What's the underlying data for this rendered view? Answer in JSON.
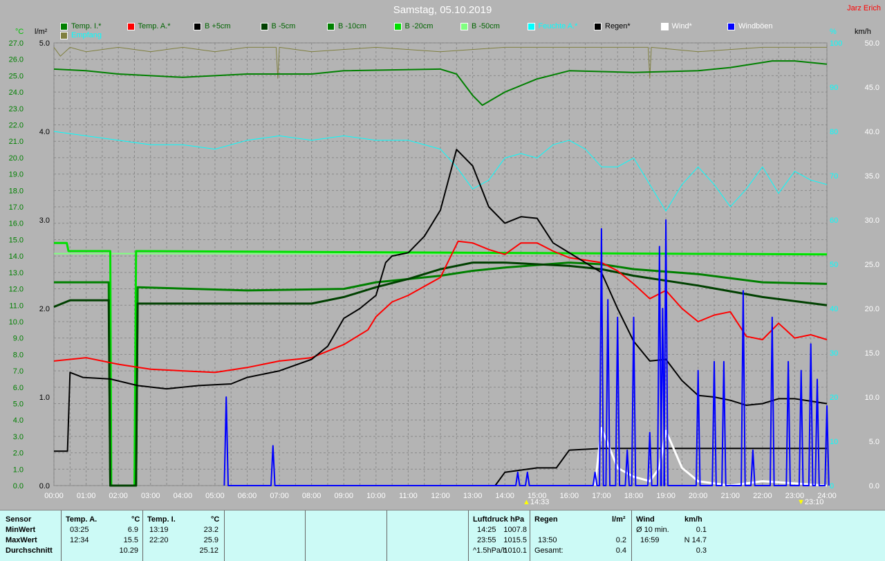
{
  "title": "Samstag, 05.10.2019",
  "author": "Jarz Erich",
  "legend": [
    {
      "label": "Temp. I.*",
      "color": "#008000",
      "text": "#006400"
    },
    {
      "label": "Temp. A.*",
      "color": "#ff0000",
      "text": "#006400"
    },
    {
      "label": "B +5cm",
      "color": "#000000",
      "text": "#006400"
    },
    {
      "label": "B -5cm",
      "color": "#004000",
      "text": "#006400"
    },
    {
      "label": "B -10cm",
      "color": "#008000",
      "text": "#006400"
    },
    {
      "label": "B -20cm",
      "color": "#00e000",
      "text": "#006400"
    },
    {
      "label": "B -50cm",
      "color": "#80ff80",
      "text": "#006400"
    },
    {
      "label": "Feuchte A.*",
      "color": "#00ffff",
      "text": "#00ffff"
    },
    {
      "label": "Regen*",
      "color": "#000000",
      "text": "#000000"
    },
    {
      "label": "Wind*",
      "color": "#ffffff",
      "text": "#ffffff"
    },
    {
      "label": "Windböen",
      "color": "#0000ff",
      "text": "#ffffff"
    },
    {
      "label": "Empfang",
      "color": "#808040",
      "text": "#00ffff"
    }
  ],
  "axes": {
    "left1_unit": "°C",
    "left2_unit": "l/m²",
    "right1_unit": "%",
    "right2_unit": "km/h"
  },
  "markers": {
    "sunrise": "14:33",
    "sunset": "23:10"
  },
  "chart_data": {
    "type": "line",
    "x_unit": "hour",
    "xlim": [
      0,
      24
    ],
    "x_ticks": [
      "00:00",
      "01:00",
      "02:00",
      "03:00",
      "04:00",
      "05:00",
      "06:00",
      "07:00",
      "08:00",
      "09:00",
      "10:00",
      "11:00",
      "12:00",
      "13:00",
      "14:00",
      "15:00",
      "16:00",
      "17:00",
      "18:00",
      "19:00",
      "20:00",
      "21:00",
      "22:00",
      "23:00",
      "24:00"
    ],
    "y_temp": [
      0,
      27
    ],
    "y_rain": [
      0,
      5
    ],
    "y_hum": [
      0,
      100
    ],
    "y_wind": [
      0,
      50
    ],
    "series": [
      {
        "name": "Empfang",
        "axis": "hum",
        "color": "#808040",
        "width": 1,
        "values": [
          [
            0,
            99
          ],
          [
            0.2,
            97
          ],
          [
            0.5,
            99
          ],
          [
            1,
            98
          ],
          [
            2,
            99
          ],
          [
            3,
            98
          ],
          [
            4,
            99
          ],
          [
            5,
            98
          ],
          [
            6,
            99
          ],
          [
            6.9,
            99
          ],
          [
            6.95,
            92
          ],
          [
            7,
            99
          ],
          [
            8,
            98
          ],
          [
            10,
            99
          ],
          [
            12,
            98
          ],
          [
            14,
            99
          ],
          [
            16,
            99
          ],
          [
            18,
            99
          ],
          [
            18.45,
            99
          ],
          [
            18.5,
            92
          ],
          [
            18.55,
            99
          ],
          [
            20,
            98
          ],
          [
            22,
            99
          ],
          [
            24,
            99
          ]
        ]
      },
      {
        "name": "Temp. I.",
        "axis": "temp",
        "color": "#008000",
        "width": 2,
        "values": [
          [
            0,
            25.4
          ],
          [
            1,
            25.3
          ],
          [
            2,
            25.1
          ],
          [
            3,
            25.0
          ],
          [
            4,
            24.9
          ],
          [
            6,
            25.1
          ],
          [
            8,
            25.1
          ],
          [
            9,
            25.3
          ],
          [
            12,
            25.4
          ],
          [
            12.5,
            25.1
          ],
          [
            13.0,
            23.8
          ],
          [
            13.3,
            23.2
          ],
          [
            14,
            24.0
          ],
          [
            15,
            24.8
          ],
          [
            16,
            25.3
          ],
          [
            18,
            25.2
          ],
          [
            20,
            25.3
          ],
          [
            21,
            25.5
          ],
          [
            22,
            25.8
          ],
          [
            22.3,
            25.9
          ],
          [
            23,
            25.9
          ],
          [
            24,
            25.7
          ]
        ]
      },
      {
        "name": "Feuchte A.",
        "axis": "hum",
        "color": "#00ffff",
        "width": 1,
        "values": [
          [
            0,
            80
          ],
          [
            1,
            79
          ],
          [
            2,
            78
          ],
          [
            3,
            77
          ],
          [
            4,
            77
          ],
          [
            5,
            76
          ],
          [
            6,
            78
          ],
          [
            7,
            79
          ],
          [
            8,
            78
          ],
          [
            9,
            79
          ],
          [
            10,
            78
          ],
          [
            11,
            78
          ],
          [
            12,
            76
          ],
          [
            12.5,
            72
          ],
          [
            13,
            67
          ],
          [
            13.5,
            69
          ],
          [
            14,
            74
          ],
          [
            14.5,
            75
          ],
          [
            15,
            74
          ],
          [
            15.5,
            77
          ],
          [
            16,
            78
          ],
          [
            16.5,
            76
          ],
          [
            17,
            72
          ],
          [
            17.5,
            72
          ],
          [
            18,
            74
          ],
          [
            18.5,
            68
          ],
          [
            19,
            62
          ],
          [
            19.5,
            68
          ],
          [
            20,
            72
          ],
          [
            20.5,
            68
          ],
          [
            21,
            63
          ],
          [
            21.5,
            67
          ],
          [
            22,
            72
          ],
          [
            22.5,
            66
          ],
          [
            23,
            71
          ],
          [
            23.5,
            69
          ],
          [
            24,
            68
          ]
        ]
      },
      {
        "name": "B -50cm",
        "axis": "temp",
        "color": "#80ff80",
        "width": 2,
        "values": [
          [
            0,
            14.15
          ],
          [
            24,
            14.15
          ]
        ]
      },
      {
        "name": "B -20cm",
        "axis": "temp",
        "color": "#00e000",
        "width": 3,
        "values": [
          [
            0,
            14.8
          ],
          [
            0.4,
            14.8
          ],
          [
            0.45,
            14.3
          ],
          [
            1.75,
            14.3
          ],
          [
            1.78,
            0
          ],
          [
            2.5,
            0
          ],
          [
            2.55,
            14.3
          ],
          [
            24,
            14.1
          ]
        ]
      },
      {
        "name": "B -10cm",
        "axis": "temp",
        "color": "#008000",
        "width": 3,
        "values": [
          [
            0,
            12.4
          ],
          [
            1.7,
            12.4
          ],
          [
            1.75,
            0
          ],
          [
            2.55,
            0
          ],
          [
            2.6,
            12.1
          ],
          [
            6,
            11.9
          ],
          [
            9,
            12.0
          ],
          [
            10,
            12.4
          ],
          [
            12,
            12.8
          ],
          [
            13,
            13.1
          ],
          [
            14,
            13.3
          ],
          [
            16,
            13.6
          ],
          [
            17,
            13.5
          ],
          [
            18,
            13.2
          ],
          [
            20,
            12.9
          ],
          [
            22,
            12.4
          ],
          [
            24,
            12.3
          ]
        ]
      },
      {
        "name": "B -5cm",
        "axis": "temp",
        "color": "#004000",
        "width": 3,
        "values": [
          [
            0,
            10.9
          ],
          [
            0.5,
            11.3
          ],
          [
            1.7,
            11.3
          ],
          [
            1.75,
            0
          ],
          [
            2.55,
            0
          ],
          [
            2.6,
            11.1
          ],
          [
            8,
            11.1
          ],
          [
            9,
            11.5
          ],
          [
            10,
            12.1
          ],
          [
            11,
            12.6
          ],
          [
            12,
            13.2
          ],
          [
            13,
            13.6
          ],
          [
            14,
            13.6
          ],
          [
            16,
            13.4
          ],
          [
            17,
            13.2
          ],
          [
            18,
            12.8
          ],
          [
            20,
            12.2
          ],
          [
            22,
            11.5
          ],
          [
            24,
            11.0
          ]
        ]
      },
      {
        "name": "Temp. A.",
        "axis": "temp",
        "color": "#ff0000",
        "width": 2,
        "values": [
          [
            0,
            7.6
          ],
          [
            1,
            7.8
          ],
          [
            2,
            7.4
          ],
          [
            3,
            7.1
          ],
          [
            4,
            7.0
          ],
          [
            5,
            6.9
          ],
          [
            6,
            7.2
          ],
          [
            7,
            7.6
          ],
          [
            8,
            7.8
          ],
          [
            9,
            8.6
          ],
          [
            9.75,
            9.5
          ],
          [
            10,
            10.3
          ],
          [
            10.5,
            11.2
          ],
          [
            11,
            11.6
          ],
          [
            12,
            12.7
          ],
          [
            12.55,
            14.9
          ],
          [
            13,
            14.8
          ],
          [
            13.5,
            14.4
          ],
          [
            14,
            14.1
          ],
          [
            14.5,
            14.8
          ],
          [
            15,
            14.8
          ],
          [
            15.5,
            14.3
          ],
          [
            16,
            13.9
          ],
          [
            17,
            13.6
          ],
          [
            17.5,
            13.1
          ],
          [
            18,
            12.3
          ],
          [
            18.5,
            11.4
          ],
          [
            19,
            11.9
          ],
          [
            19.5,
            10.8
          ],
          [
            20,
            10.0
          ],
          [
            20.5,
            10.4
          ],
          [
            21,
            10.6
          ],
          [
            21.5,
            9.1
          ],
          [
            22,
            8.9
          ],
          [
            22.5,
            9.9
          ],
          [
            23,
            9.0
          ],
          [
            23.5,
            9.2
          ],
          [
            24,
            8.9
          ]
        ]
      },
      {
        "name": "B +5cm",
        "axis": "temp",
        "color": "#000000",
        "width": 2,
        "values": [
          [
            0,
            2.1
          ],
          [
            0.42,
            2.1
          ],
          [
            0.5,
            6.9
          ],
          [
            0.9,
            6.6
          ],
          [
            1.75,
            6.5
          ],
          [
            2.6,
            6.1
          ],
          [
            3.5,
            5.9
          ],
          [
            4.5,
            6.1
          ],
          [
            5.5,
            6.2
          ],
          [
            6,
            6.6
          ],
          [
            7,
            7.0
          ],
          [
            8,
            7.7
          ],
          [
            8.5,
            8.5
          ],
          [
            9,
            10.2
          ],
          [
            9.5,
            10.8
          ],
          [
            10,
            11.6
          ],
          [
            10.3,
            13.6
          ],
          [
            10.5,
            14.0
          ],
          [
            11,
            14.2
          ],
          [
            11.5,
            15.2
          ],
          [
            12,
            16.8
          ],
          [
            12.5,
            20.5
          ],
          [
            13,
            19.5
          ],
          [
            13.5,
            17.0
          ],
          [
            14,
            16.0
          ],
          [
            14.5,
            16.4
          ],
          [
            15,
            16.3
          ],
          [
            15.5,
            14.8
          ],
          [
            16,
            14.2
          ],
          [
            17,
            13.0
          ],
          [
            17.5,
            10.8
          ],
          [
            18,
            8.8
          ],
          [
            18.5,
            7.6
          ],
          [
            19,
            7.7
          ],
          [
            19.5,
            6.4
          ],
          [
            20,
            5.5
          ],
          [
            20.5,
            5.4
          ],
          [
            21,
            5.2
          ],
          [
            21.5,
            4.9
          ],
          [
            22,
            5.0
          ],
          [
            22.5,
            5.3
          ],
          [
            23,
            5.3
          ],
          [
            24,
            5.0
          ]
        ]
      },
      {
        "name": "Regen",
        "axis": "rain",
        "color": "#000000",
        "width": 2,
        "values": [
          [
            13.7,
            0
          ],
          [
            14,
            0.15
          ],
          [
            15,
            0.2
          ],
          [
            15.6,
            0.2
          ],
          [
            16,
            0.4
          ],
          [
            17,
            0.42
          ],
          [
            24,
            0.42
          ]
        ]
      },
      {
        "name": "Wind",
        "axis": "wind",
        "color": "#ffffff",
        "width": 3,
        "values": [
          [
            16.8,
            0
          ],
          [
            17,
            6.5
          ],
          [
            17.5,
            2
          ],
          [
            18,
            1
          ],
          [
            18.5,
            0.5
          ],
          [
            18.8,
            2
          ],
          [
            19,
            6.2
          ],
          [
            19.5,
            2
          ],
          [
            20,
            0.5
          ],
          [
            21,
            0
          ],
          [
            22,
            0.5
          ],
          [
            24,
            0
          ]
        ]
      },
      {
        "name": "Windböen",
        "axis": "wind",
        "color": "#0000ff",
        "width": 2,
        "spikes": true,
        "values": [
          [
            5.35,
            10
          ],
          [
            6.8,
            4.5
          ],
          [
            14.4,
            1.5
          ],
          [
            14.7,
            1.5
          ],
          [
            16.8,
            1.5
          ],
          [
            17.0,
            29
          ],
          [
            17.2,
            21
          ],
          [
            17.5,
            19
          ],
          [
            17.8,
            4
          ],
          [
            18.0,
            19
          ],
          [
            18.5,
            6
          ],
          [
            18.8,
            27
          ],
          [
            18.9,
            20
          ],
          [
            19.0,
            30
          ],
          [
            20.0,
            13
          ],
          [
            20.5,
            14
          ],
          [
            20.8,
            14
          ],
          [
            21.4,
            22
          ],
          [
            21.7,
            4
          ],
          [
            22.3,
            19
          ],
          [
            22.8,
            14
          ],
          [
            23.2,
            13
          ],
          [
            23.5,
            16
          ],
          [
            23.7,
            12
          ],
          [
            24,
            9
          ]
        ]
      }
    ]
  },
  "table": {
    "sensor": "Sensor",
    "min": "MinWert",
    "max": "MaxWert",
    "avg": "Durchschnitt",
    "tempA": {
      "h": "Temp. A.",
      "u": "°C",
      "min_t": "03:25",
      "min_v": "6.9",
      "max_t": "12:34",
      "max_v": "15.5",
      "avg": "10.29"
    },
    "tempI": {
      "h": "Temp. I.",
      "u": "°C",
      "min_t": "13:19",
      "min_v": "23.2",
      "max_t": "22:20",
      "max_v": "25.9",
      "avg": "25.12"
    },
    "luft": {
      "h": "Luftdruck",
      "u": "hPa",
      "min_t": "14:25",
      "min_v": "1007.8",
      "max_t": "23:55",
      "max_v": "1015.5",
      "avg_t": "^1.5hPa/h",
      "avg": "1010.1"
    },
    "regen": {
      "h": "Regen",
      "u": "l/m²",
      "max_t": "13:50",
      "max_v": "0.2",
      "avg_t": "Gesamt:",
      "avg": "0.4"
    },
    "wind": {
      "h": "Wind",
      "u": "km/h",
      "min_t": "Ø 10 min.",
      "min_v": "0.1",
      "max_t": "16:59",
      "max_v": "N 14.7",
      "avg": "0.3"
    }
  }
}
